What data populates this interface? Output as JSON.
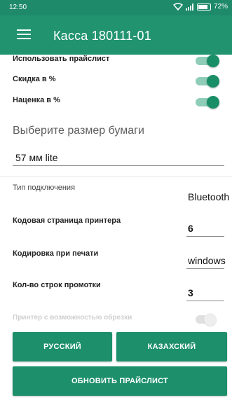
{
  "status_bar": {
    "time": "12:50",
    "battery": "72%"
  },
  "toolbar": {
    "title": "Касса 180111-01",
    "menu_icon": "hamburger-icon"
  },
  "toggles": [
    {
      "label": "Использовать прайслист",
      "on": true
    },
    {
      "label": "Скидка в %",
      "on": true
    },
    {
      "label": "Наценка в %",
      "on": true
    }
  ],
  "paper": {
    "title": "Выберите размер бумаги",
    "value": "57 мм lite"
  },
  "connection": {
    "label": "Тип подключения",
    "value": "Bluetooth"
  },
  "codepage": {
    "label": "Кодовая страница принтера",
    "value": "6"
  },
  "encoding": {
    "label": "Кодировка при печати",
    "value": "windows"
  },
  "feed_lines": {
    "label": "Кол-во строк промотки",
    "value": "3"
  },
  "cutter": {
    "label": "Принтер с возможностью обрезки",
    "on": false,
    "enabled": false
  },
  "buttons": {
    "russian": "РУССКИЙ",
    "kazakh": "КАЗАХСКИЙ",
    "update_pricelist": "ОБНОВИТЬ ПРАЙСЛИСТ"
  },
  "colors": {
    "primary": "#21946f",
    "status_bar": "#1f8a6a",
    "accent": "#1a8f67"
  }
}
